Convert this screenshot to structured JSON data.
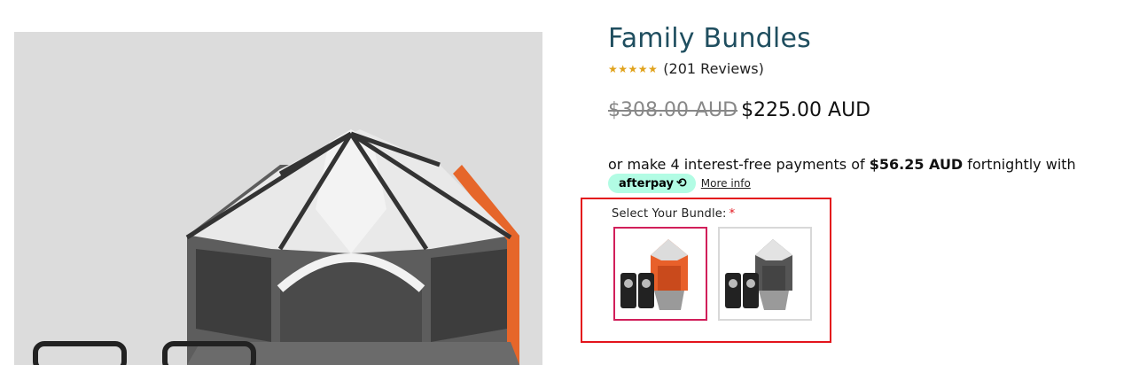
{
  "product": {
    "title": "Family Bundles",
    "stars": "★★★★★",
    "reviews": "(201 Reviews)",
    "old_price": "$308.00 AUD",
    "new_price": "$225.00 AUD"
  },
  "payment": {
    "text_before": "or make 4 interest-free payments of ",
    "amount": "$56.25 AUD",
    "text_after": " fortnightly with",
    "afterpay_label": "afterpay",
    "afterpay_icon": "⟲",
    "more_info": "More info"
  },
  "bundle": {
    "label": "Select Your Bundle:",
    "required_mark": "*",
    "options": [
      {
        "name": "orange-tent-bundle",
        "selected": true
      },
      {
        "name": "grey-tent-bundle",
        "selected": false
      }
    ]
  },
  "colors": {
    "title": "#1f4e5f",
    "star": "#e0a21b",
    "afterpay_bg": "#b2fce4",
    "highlight_box": "#e3141c",
    "selected_border": "#d11f5a"
  }
}
